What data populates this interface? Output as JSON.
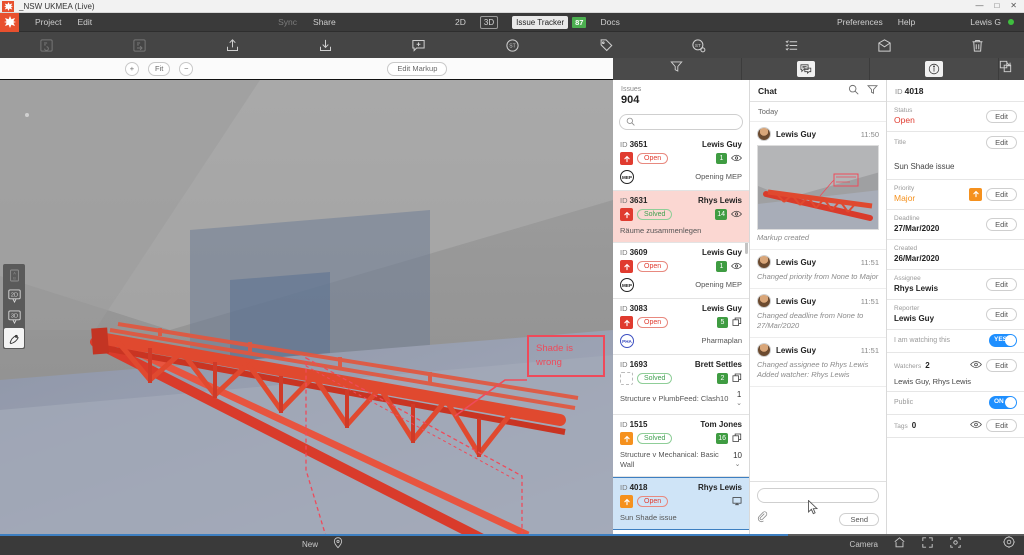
{
  "window": {
    "title": "_NSW UKMEA (Live)",
    "logo_icon": "app-logo-icon",
    "minimize": "—",
    "maximize": "□",
    "close": "✕"
  },
  "menubar": {
    "logo_icon": "app-logo-icon",
    "left_items": [
      {
        "label": "Project",
        "dim": false
      },
      {
        "label": "Edit",
        "dim": false
      }
    ],
    "mid_items": [
      {
        "label": "Sync",
        "dim": true
      },
      {
        "label": "Share",
        "dim": false
      }
    ],
    "center": {
      "view_2d": "2D",
      "view_3d": "3D",
      "issue_tracker": "Issue Tracker",
      "issue_badge": "87",
      "docs": "Docs"
    },
    "right_items": [
      {
        "label": "Preferences"
      },
      {
        "label": "Help"
      }
    ],
    "user": "Lewis G",
    "status_dot_color": "#3fbf3f"
  },
  "toolbar": {
    "items": [
      {
        "name": "save-revision-icon",
        "dim": true
      },
      {
        "name": "export-revision-icon",
        "dim": true
      },
      {
        "name": "upload-icon",
        "dim": false
      },
      {
        "name": "download-icon",
        "dim": false
      },
      {
        "name": "add-comment-icon",
        "dim": false
      },
      {
        "name": "status-icon",
        "dim": false
      },
      {
        "name": "tags-icon",
        "dim": false
      },
      {
        "name": "status-settings-icon",
        "dim": false
      },
      {
        "name": "list-settings-icon",
        "dim": false
      },
      {
        "name": "mail-icon",
        "dim": false
      },
      {
        "name": "delete-icon",
        "dim": false
      }
    ]
  },
  "viewport": {
    "zoom_in": "+",
    "fit": "Fit",
    "zoom_out": "−",
    "edit_markup": "Edit Markup",
    "markup_text": "Shade is wrong",
    "markup_color": "#ef4a5a",
    "left_tools": [
      {
        "name": "ab-compare-icon",
        "label": "A\nB",
        "state": "faded"
      },
      {
        "name": "view-2d-icon",
        "label": "2D",
        "state": "normal"
      },
      {
        "name": "view-3d-icon",
        "label": "3D",
        "state": "normal"
      },
      {
        "name": "markup-pen-icon",
        "label": "✏",
        "state": "selected"
      }
    ]
  },
  "panel_tabs": [
    {
      "name": "filter-tab",
      "icon": "filter-icon",
      "active": false
    },
    {
      "name": "chat-tab",
      "icon": "chat-icon",
      "active": true
    },
    {
      "name": "info-tab",
      "icon": "info-icon",
      "active": true
    },
    {
      "name": "expand-tab",
      "icon": "expand-icon",
      "active": false
    }
  ],
  "issues": {
    "label": "Issues",
    "count": "904",
    "search_placeholder": "",
    "search_icon": "search-icon",
    "items": [
      {
        "id_label": "ID",
        "id": "3651",
        "user": "Lewis Guy",
        "priority": "red",
        "priority_icon": "arrow-up-icon",
        "status": "Open",
        "status_type": "open",
        "comments": "1",
        "side_icon": "eye-icon",
        "title": "Opening MEP",
        "discipline": "MEP",
        "discipline_color": "dark",
        "count": "",
        "highlight": "none"
      },
      {
        "id_label": "ID",
        "id": "3631",
        "user": "Rhys Lewis",
        "priority": "red",
        "priority_icon": "arrow-up-icon",
        "status": "Solved",
        "status_type": "solved",
        "comments": "14",
        "side_icon": "eye-icon",
        "title": "Räume zusammenlegen",
        "discipline": "",
        "discipline_color": "",
        "count": "",
        "highlight": "solved-hl"
      },
      {
        "id_label": "ID",
        "id": "3609",
        "user": "Lewis Guy",
        "priority": "red",
        "priority_icon": "arrow-up-icon",
        "status": "Open",
        "status_type": "open",
        "comments": "1",
        "side_icon": "eye-icon",
        "title": "Opening MEP",
        "discipline": "MEP",
        "discipline_color": "dark",
        "count": "",
        "highlight": "none"
      },
      {
        "id_label": "ID",
        "id": "3083",
        "user": "Lewis Guy",
        "priority": "red",
        "priority_icon": "arrow-up-icon",
        "status": "Open",
        "status_type": "open",
        "comments": "5",
        "side_icon": "clash-icon",
        "title": "Pharmaplan",
        "discipline": "PHA",
        "discipline_color": "blue",
        "count": "",
        "highlight": "none"
      },
      {
        "id_label": "ID",
        "id": "1693",
        "user": "Brett Settles",
        "priority": "none",
        "priority_icon": "",
        "status": "Solved",
        "status_type": "solved",
        "comments": "2",
        "side_icon": "clash-icon",
        "title": "Structure v PlumbFeed: Clash10",
        "discipline": "",
        "discipline_color": "",
        "count": "1",
        "highlight": "none"
      },
      {
        "id_label": "ID",
        "id": "1515",
        "user": "Tom Jones",
        "priority": "orange",
        "priority_icon": "arrow-up-icon",
        "status": "Solved",
        "status_type": "solved",
        "comments": "16",
        "side_icon": "clash-icon",
        "title": "Structure v Mechanical: Basic Wall",
        "discipline": "",
        "discipline_color": "",
        "count": "10",
        "highlight": "none"
      },
      {
        "id_label": "ID",
        "id": "4018",
        "user": "Rhys Lewis",
        "priority": "orange",
        "priority_icon": "arrow-up-icon",
        "status": "Open",
        "status_type": "open",
        "comments": "",
        "side_icon": "markup-icon",
        "title": "Sun Shade issue",
        "discipline": "",
        "discipline_color": "",
        "count": "",
        "highlight": "selected"
      }
    ]
  },
  "chat": {
    "title": "Chat",
    "search_icon": "search-icon",
    "filter_icon": "filter-icon",
    "day": "Today",
    "messages": [
      {
        "user": "Lewis Guy",
        "time": "11:50",
        "text": "Markup created",
        "has_image": true
      },
      {
        "user": "Lewis Guy",
        "time": "11:51",
        "text": "Changed priority from None to Major",
        "has_image": false
      },
      {
        "user": "Lewis Guy",
        "time": "11:51",
        "text": "Changed deadline from None to 27/Mar/2020",
        "has_image": false
      },
      {
        "user": "Lewis Guy",
        "time": "11:51",
        "text": "Changed assignee to Rhys Lewis Added watcher: Rhys Lewis",
        "has_image": false
      }
    ],
    "input_value": "",
    "input_placeholder": "",
    "attach_icon": "paperclip-icon",
    "send_label": "Send"
  },
  "details": {
    "id_label": "ID",
    "id": "4018",
    "edit_label": "Edit",
    "rows": [
      {
        "name": "status-row",
        "label": "Status",
        "value": "Open",
        "value_style": "open",
        "edit": true
      },
      {
        "name": "title-row",
        "label": "Title",
        "value": "Sun Shade issue",
        "value_style": "below",
        "edit": true
      },
      {
        "name": "priority-row",
        "label": "Priority",
        "value": "Major",
        "value_style": "major",
        "edit": true,
        "badge": "arrow-up-icon"
      },
      {
        "name": "deadline-row",
        "label": "Deadline",
        "value": "27/Mar/2020",
        "value_style": "bold",
        "edit": true
      },
      {
        "name": "created-row",
        "label": "Created",
        "value": "26/Mar/2020",
        "value_style": "bold",
        "edit": false
      },
      {
        "name": "assignee-row",
        "label": "Assignee",
        "value": "Rhys Lewis",
        "value_style": "bold",
        "edit": true
      },
      {
        "name": "reporter-row",
        "label": "Reporter",
        "value": "Lewis Guy",
        "value_style": "bold",
        "edit": true
      }
    ],
    "watching_label": "I am watching this",
    "watching_state": "YES",
    "watchers_label": "Watchers",
    "watchers_count": "2",
    "watchers_names": "Lewis Guy, Rhys Lewis",
    "public_label": "Public",
    "public_state": "ON",
    "tags_label": "Tags",
    "tags_count": "0",
    "toggle_color": "#1e8fff"
  },
  "bottombar": {
    "new_label": "New",
    "pin_icon": "pin-icon",
    "camera_label": "Camera",
    "home_icon": "home-icon",
    "fullscreen_icon": "fullscreen-icon",
    "focus_icon": "focus-icon",
    "settings_icon": "settings-icon",
    "progress_percent": 77
  }
}
